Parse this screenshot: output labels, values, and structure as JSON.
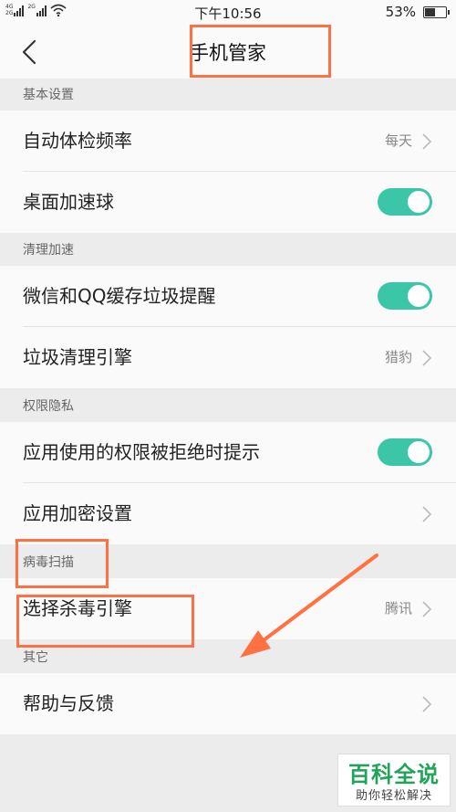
{
  "status_bar": {
    "network_labels": [
      "4G",
      "2G"
    ],
    "network_label_2": "2G",
    "time": "下午10:56",
    "battery_text": "53%",
    "battery_level": 0.53
  },
  "nav": {
    "title": "手机管家"
  },
  "sections": {
    "basic": {
      "header": "基本设置",
      "auto_check": {
        "label": "自动体检频率",
        "value": "每天"
      },
      "float_ball": {
        "label": "桌面加速球",
        "enabled": true
      }
    },
    "clean": {
      "header": "清理加速",
      "wechat_qq": {
        "label": "微信和QQ缓存垃圾提醒",
        "enabled": true
      },
      "engine": {
        "label": "垃圾清理引擎",
        "value": "猎豹"
      }
    },
    "privacy": {
      "header": "权限隐私",
      "permission_prompt": {
        "label": "应用使用的权限被拒绝时提示",
        "enabled": true
      },
      "app_encrypt": {
        "label": "应用加密设置"
      }
    },
    "virus": {
      "header": "病毒扫描",
      "engine": {
        "label": "选择杀毒引擎",
        "value": "腾讯"
      }
    },
    "other": {
      "header": "其它",
      "feedback": {
        "label": "帮助与反馈"
      }
    }
  },
  "watermark": {
    "main": "百科全说",
    "sub": "助你轻松解决"
  },
  "colors": {
    "toggle_on": "#3cc6a8",
    "highlight": "#ff7043",
    "watermark_green": "#22a35a"
  }
}
